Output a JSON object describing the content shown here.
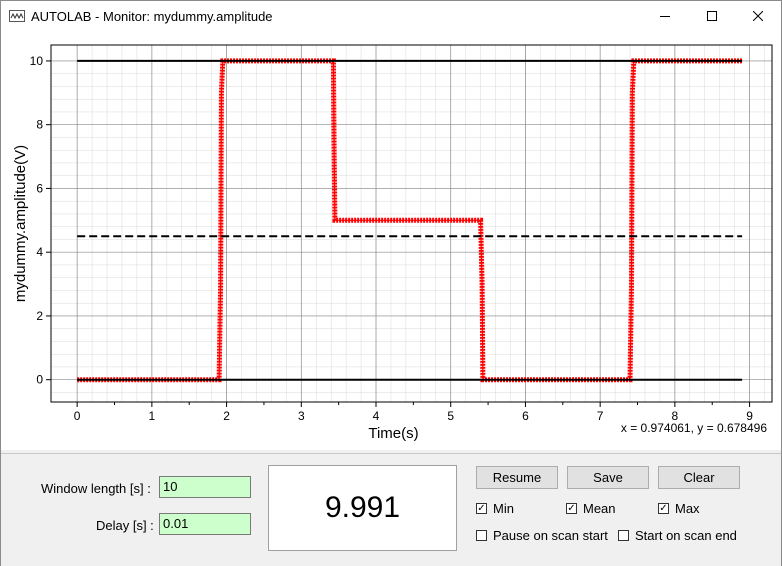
{
  "window": {
    "title": "AUTOLAB - Monitor: mydummy.amplitude",
    "minimize_icon": "minimize-icon",
    "maximize_icon": "maximize-icon",
    "close_icon": "close-icon"
  },
  "plot": {
    "coord_readout": "x = 0.974061, y = 0.678496"
  },
  "chart_data": {
    "type": "line",
    "title": "",
    "xlabel": "Time(s)",
    "ylabel": "mydummy.amplitude(V)",
    "xlim": [
      -0.35,
      9.3
    ],
    "ylim": [
      -0.7,
      10.5
    ],
    "x_ticks": [
      "0",
      "1",
      "2",
      "3",
      "4",
      "5",
      "6",
      "7",
      "8",
      "9"
    ],
    "y_ticks": [
      "0",
      "2",
      "4",
      "6",
      "8",
      "10"
    ],
    "grid": true,
    "series": [
      {
        "role": "signal",
        "color": "#ff0000",
        "x": [
          0,
          1.9,
          1.92,
          1.93,
          1.95,
          3.43,
          3.44,
          3.45,
          5.4,
          5.42,
          5.43,
          7.4,
          7.42,
          7.43,
          7.45,
          8.9
        ],
        "y": [
          0,
          0,
          3,
          9,
          10,
          10,
          7,
          5,
          5,
          3,
          0,
          0,
          3,
          9,
          10,
          10
        ]
      },
      {
        "role": "max",
        "color": "#000000",
        "x": [
          0,
          8.9
        ],
        "y": [
          10,
          10
        ]
      },
      {
        "role": "mean",
        "color": "#000000",
        "dashed": true,
        "x": [
          0,
          8.9
        ],
        "y": [
          4.5,
          4.5
        ]
      },
      {
        "role": "min",
        "color": "#000000",
        "x": [
          0,
          8.9
        ],
        "y": [
          0,
          0
        ]
      }
    ]
  },
  "controls": {
    "window_length_label": "Window length [s] :",
    "window_length_value": "10",
    "delay_label": "Delay [s] :",
    "delay_value": "0.01",
    "current_value": "9.991",
    "resume_label": "Resume",
    "save_label": "Save",
    "clear_label": "Clear",
    "min_label": "Min",
    "min_checked": true,
    "mean_label": "Mean",
    "mean_checked": true,
    "max_label": "Max",
    "max_checked": true,
    "pause_label": "Pause on scan start",
    "pause_checked": false,
    "start_label": "Start on scan end",
    "start_checked": false
  }
}
